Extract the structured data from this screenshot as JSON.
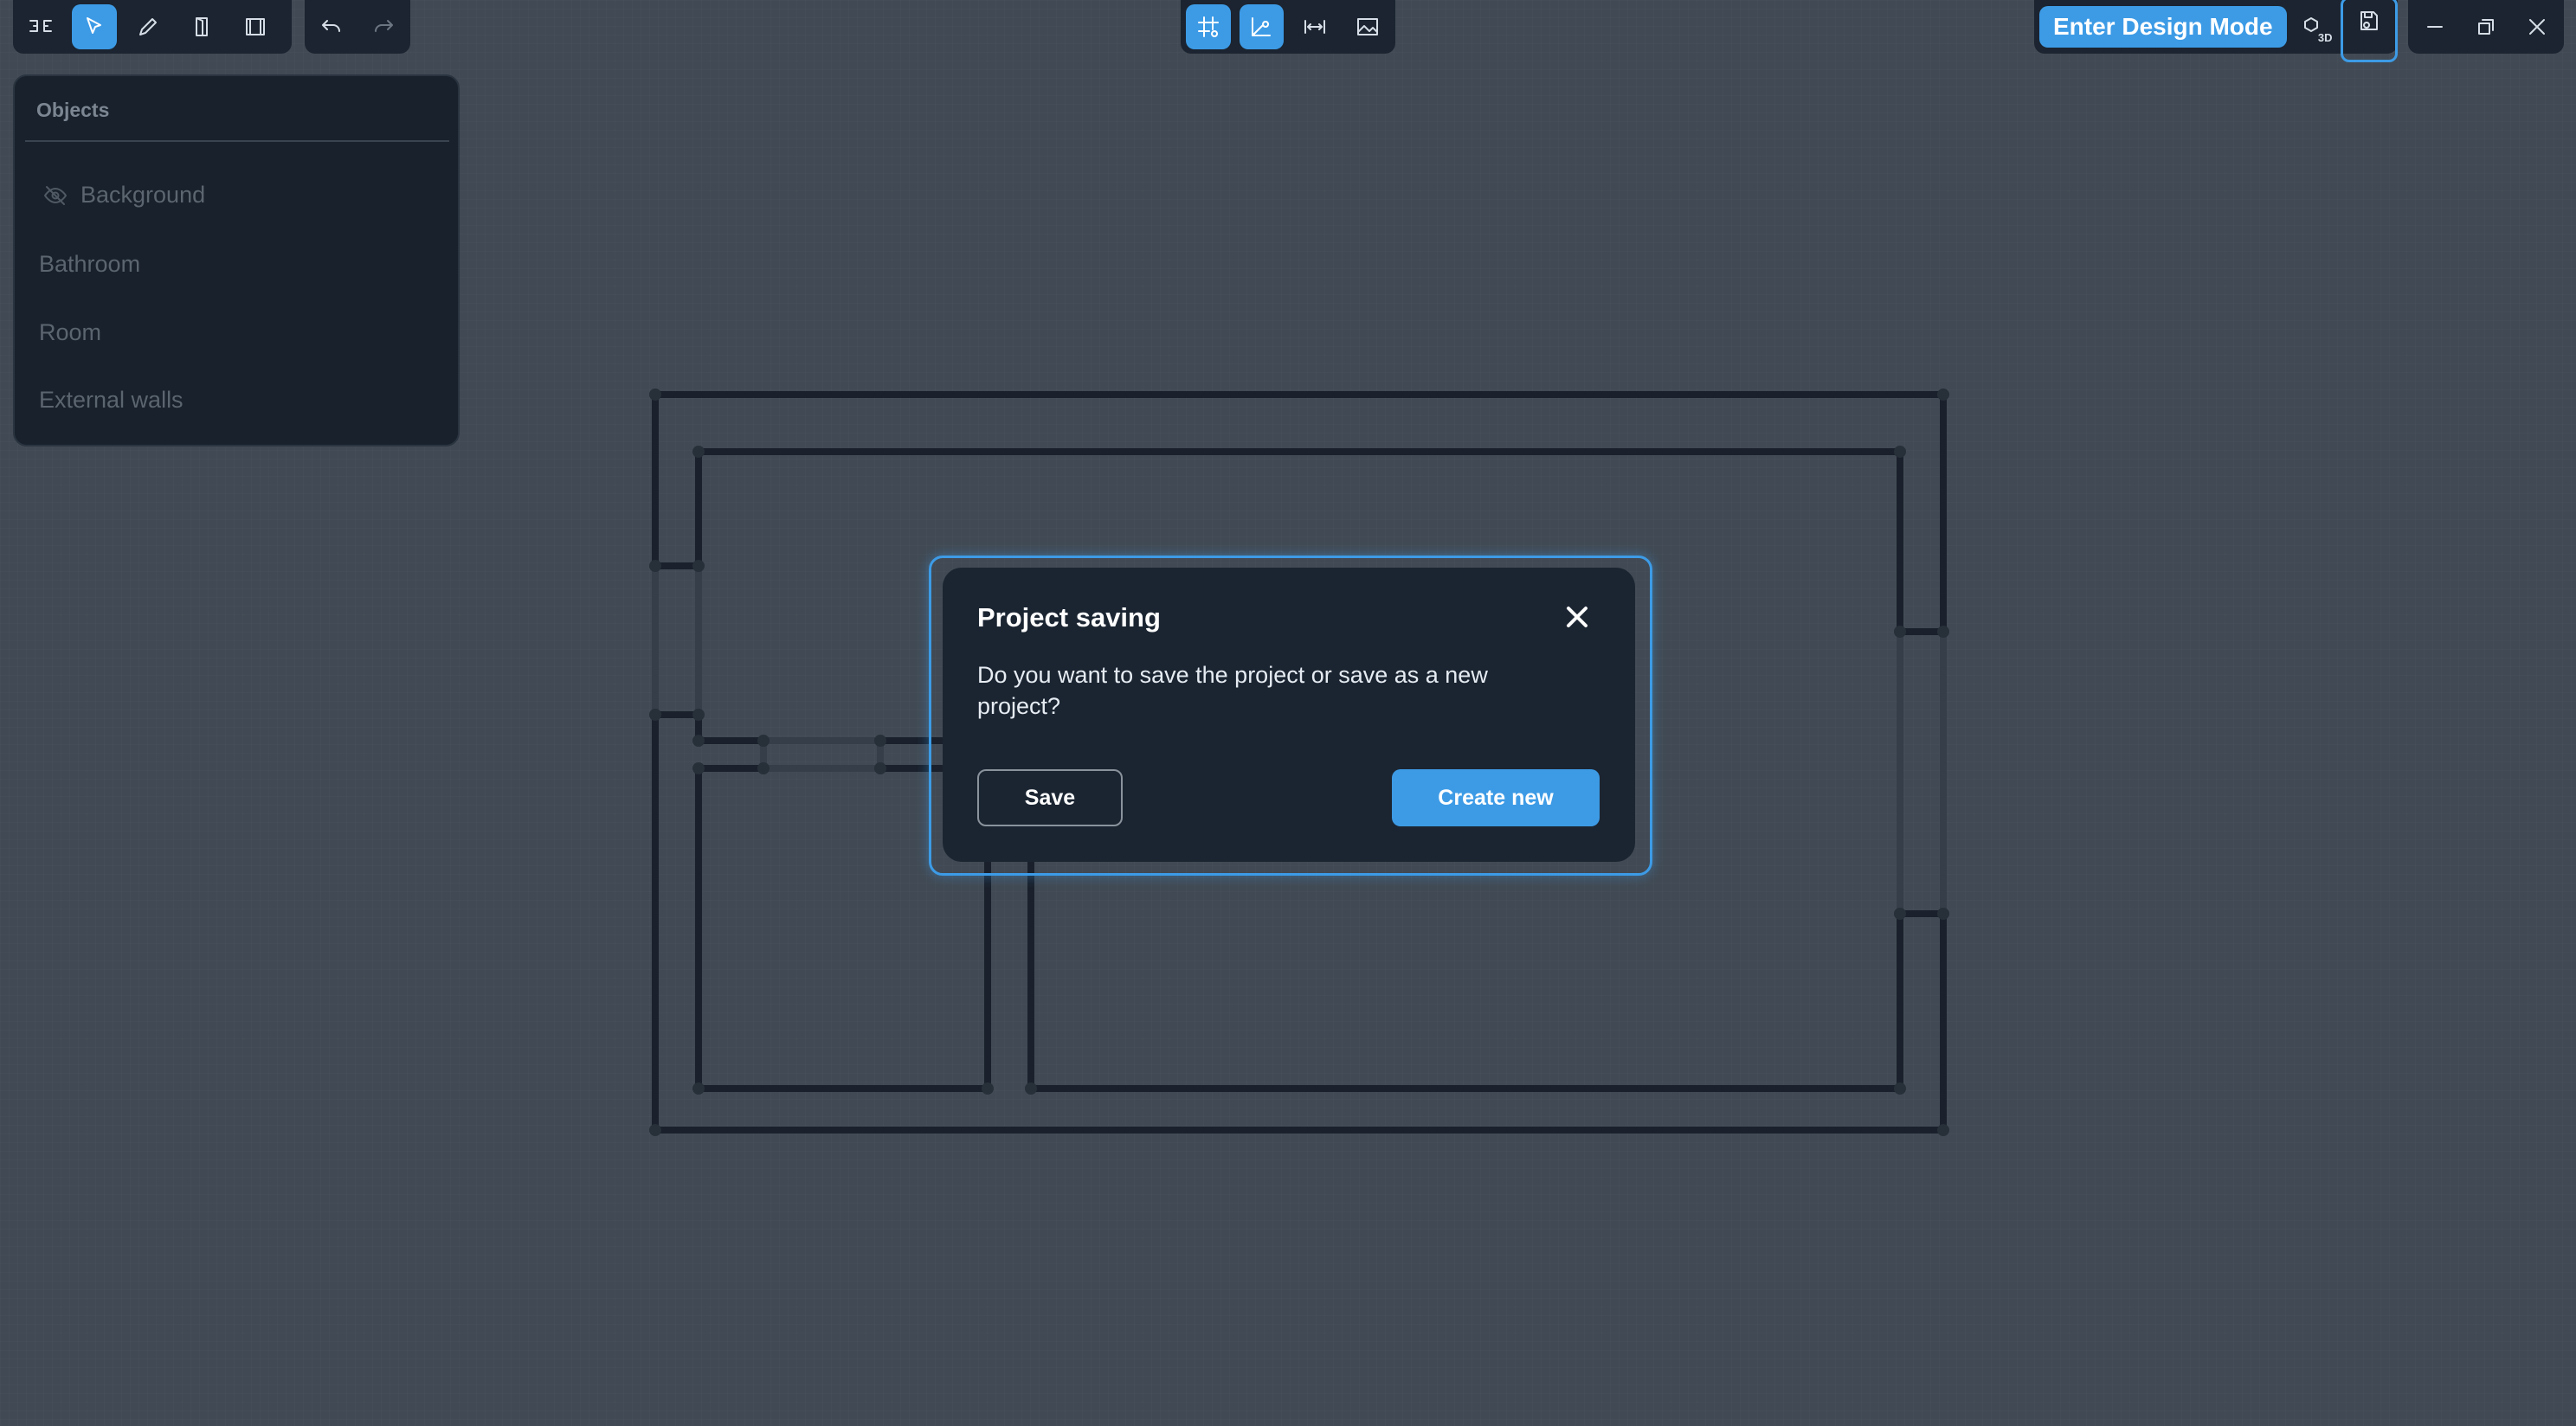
{
  "toolbar_left": {
    "logo": "logo-icon",
    "tools": [
      {
        "name": "select-icon",
        "active": true
      },
      {
        "name": "pencil-icon",
        "active": false
      },
      {
        "name": "door-icon",
        "active": false
      },
      {
        "name": "window-icon",
        "active": false
      }
    ],
    "history": [
      "undo-icon",
      "redo-icon"
    ]
  },
  "toolbar_center": {
    "tools": [
      {
        "name": "grid-snap-icon",
        "active": true
      },
      {
        "name": "angle-snap-icon",
        "active": true
      },
      {
        "name": "measure-icon",
        "active": false
      },
      {
        "name": "image-icon",
        "active": false
      }
    ]
  },
  "toolbar_right": {
    "design_mode_label": "Enter Design Mode",
    "view3d_label": "3D",
    "icons": [
      "view-3d-icon",
      "save-icon",
      "minimize-icon",
      "restore-icon",
      "close-icon"
    ]
  },
  "objects_panel": {
    "title": "Objects",
    "items": [
      {
        "label": "Background",
        "hidden": true
      },
      {
        "label": "Bathroom",
        "hidden": false
      },
      {
        "label": "Room",
        "hidden": false
      },
      {
        "label": "External walls",
        "hidden": false
      }
    ]
  },
  "dialog": {
    "title": "Project saving",
    "message": "Do you want to save the project or save as a new project?",
    "save_label": "Save",
    "create_label": "Create new"
  },
  "colors": {
    "accent": "#3d9be6",
    "canvas": "#4a535d",
    "panel": "#18212c",
    "dialog": "#1b2532",
    "wall": "#1a222c"
  }
}
